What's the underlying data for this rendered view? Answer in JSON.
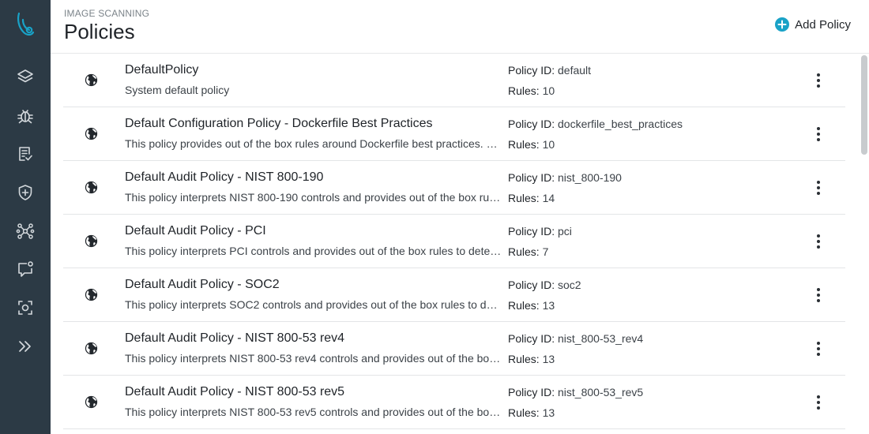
{
  "header": {
    "breadcrumb": "IMAGE SCANNING",
    "title": "Policies",
    "add_button": "Add Policy"
  },
  "sidebar": {
    "logo_icon": "brand-logo-icon",
    "items": [
      {
        "icon": "layers-icon"
      },
      {
        "icon": "bug-icon"
      },
      {
        "icon": "report-icon"
      },
      {
        "icon": "shield-plus-icon"
      },
      {
        "icon": "network-icon"
      },
      {
        "icon": "chat-alert-icon"
      },
      {
        "icon": "scan-icon"
      },
      {
        "icon": "expand-icon"
      }
    ]
  },
  "labels": {
    "policy_id": "Policy ID:",
    "rules": "Rules:"
  },
  "policies": [
    {
      "name": "DefaultPolicy",
      "description": "System default policy",
      "policy_id": "default",
      "rules": "10"
    },
    {
      "name": "Default Configuration Policy - Dockerfile Best Practices",
      "description": "This policy provides out of the box rules around Dockerfile best practices. We …",
      "policy_id": "dockerfile_best_practices",
      "rules": "10"
    },
    {
      "name": "Default Audit Policy - NIST 800-190",
      "description": "This policy interprets NIST 800-190 controls and provides out of the box rules…",
      "policy_id": "nist_800-190",
      "rules": "14"
    },
    {
      "name": "Default Audit Policy - PCI",
      "description": "This policy interprets PCI controls and provides out of the box rules to detect i…",
      "policy_id": "pci",
      "rules": "7"
    },
    {
      "name": "Default Audit Policy - SOC2",
      "description": "This policy interprets SOC2 controls and provides out of the box rules to dete…",
      "policy_id": "soc2",
      "rules": "13"
    },
    {
      "name": "Default Audit Policy - NIST 800-53 rev4",
      "description": "This policy interprets NIST 800-53 rev4 controls and provides out of the box r…",
      "policy_id": "nist_800-53_rev4",
      "rules": "13"
    },
    {
      "name": "Default Audit Policy - NIST 800-53 rev5",
      "description": "This policy interprets NIST 800-53 rev5 controls and provides out of the box r…",
      "policy_id": "nist_800-53_rev5",
      "rules": "13"
    }
  ],
  "colors": {
    "sidebar_bg": "#2c3a45",
    "accent": "#19a2c7"
  }
}
